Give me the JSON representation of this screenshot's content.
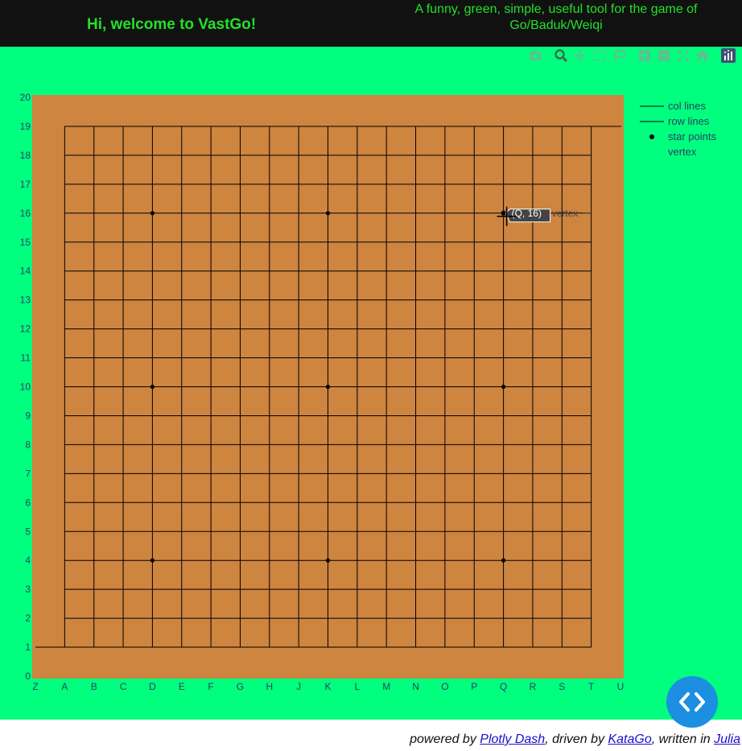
{
  "header": {
    "welcome": "Hi, welcome to VastGo!",
    "tagline": "A funny, green, simple, useful tool for the game of Go/Baduk/Weiqi"
  },
  "toolbar": {
    "icons": [
      "camera-icon",
      "zoom-icon",
      "pan-icon",
      "box-select-icon",
      "lasso-select-icon",
      "zoom-in-icon",
      "zoom-out-icon",
      "autoscale-icon",
      "reset-axes-icon",
      "plotly-logo-icon"
    ]
  },
  "colors": {
    "page_bg": "#00ff7f",
    "header_bg": "#111111",
    "header_text": "#22e02a",
    "board": "#cd853f",
    "fab": "#1d8fe0"
  },
  "chart_data": {
    "type": "scatter",
    "x_ticks": [
      "Z",
      "A",
      "B",
      "C",
      "D",
      "E",
      "F",
      "G",
      "H",
      "J",
      "K",
      "L",
      "M",
      "N",
      "O",
      "P",
      "Q",
      "R",
      "S",
      "T",
      "U"
    ],
    "y_ticks": [
      0,
      1,
      2,
      3,
      4,
      5,
      6,
      7,
      8,
      9,
      10,
      11,
      12,
      13,
      14,
      15,
      16,
      17,
      18,
      19,
      20
    ],
    "xlim": [
      0,
      20
    ],
    "ylim": [
      0,
      20
    ],
    "board_size": 19,
    "series": [
      {
        "name": "col lines",
        "mode": "lines"
      },
      {
        "name": "row lines",
        "mode": "lines"
      },
      {
        "name": "star points",
        "mode": "markers",
        "points": [
          [
            "D",
            16
          ],
          [
            "K",
            16
          ],
          [
            "Q",
            16
          ],
          [
            "D",
            10
          ],
          [
            "K",
            10
          ],
          [
            "Q",
            10
          ],
          [
            "D",
            4
          ],
          [
            "K",
            4
          ],
          [
            "Q",
            4
          ]
        ]
      },
      {
        "name": "vertex",
        "mode": "markers"
      }
    ],
    "hover": {
      "text": "(Q, 16)",
      "series": "vertex",
      "x": "Q",
      "y": 16
    },
    "legend_position": "top-right"
  },
  "footer": {
    "prefix": "powered by ",
    "link1": "Plotly Dash",
    "mid1": ", driven by ",
    "link2": "KataGo",
    "mid2": ", written in ",
    "link3": "Julia"
  }
}
